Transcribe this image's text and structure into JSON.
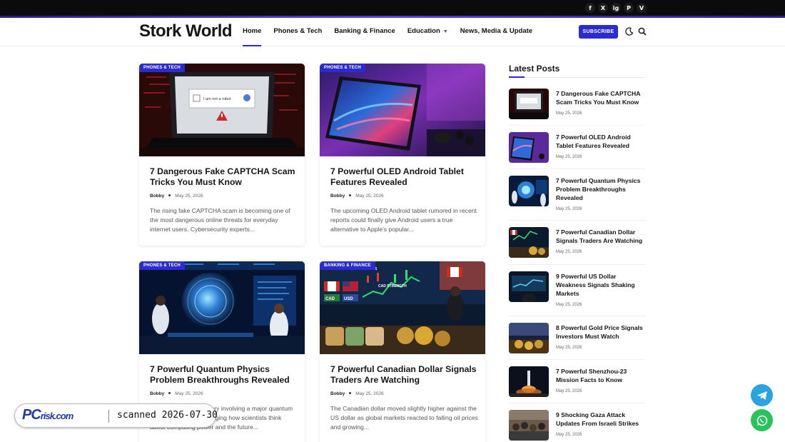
{
  "site": {
    "logo": "Stork World"
  },
  "nav": {
    "items": [
      {
        "label": "Home",
        "active": true
      },
      {
        "label": "Phones & Tech"
      },
      {
        "label": "Banking & Finance"
      },
      {
        "label": "Education",
        "dropdown": true
      },
      {
        "label": "News, Media & Update"
      }
    ],
    "subscribe_label": "SUBSCRIBE"
  },
  "socials": [
    "f",
    "X",
    "ig",
    "P",
    "V"
  ],
  "cards": [
    {
      "category": "PHONES & TECH",
      "title": "7 Dangerous Fake CAPTCHA Scam Tricks You Must Know",
      "author": "Bobby",
      "date": "May 25, 2026",
      "excerpt": "The rising fake CAPTCHA scam is becoming one of the most dangerous online threats for everyday internet users. Cybersecurity experts..."
    },
    {
      "category": "PHONES & TECH",
      "title": "7 Powerful OLED Android Tablet Features Revealed",
      "author": "Bobby",
      "date": "May 25, 2026",
      "excerpt": "The upcoming OLED Android tablet rumored in recent reports could finally give Android users a true alternative to Apple's popular..."
    },
    {
      "category": "PHONES & TECH",
      "title": "7 Powerful Quantum Physics Problem Breakthroughs Revealed",
      "author": "Bobby",
      "date": "May 25, 2026",
      "excerpt": "A new scientific discovery involving a major quantum physics problem is changing how scientists think about computing power and the future..."
    },
    {
      "category": "BANKING & FINANCE",
      "title": "7 Powerful Canadian Dollar Signals Traders Are Watching",
      "author": "Bobby",
      "date": "May 25, 2026",
      "excerpt": "The Canadian dollar moved slightly higher against the US dollar as global markets reacted to falling oil prices and growing..."
    }
  ],
  "sidebar": {
    "title": "Latest Posts",
    "posts": [
      {
        "title": "7 Dangerous Fake CAPTCHA Scam Tricks You Must Know",
        "date": "May 25, 2026"
      },
      {
        "title": "7 Powerful OLED Android Tablet Features Revealed",
        "date": "May 25, 2026"
      },
      {
        "title": "7 Powerful Quantum Physics Problem Breakthroughs Revealed",
        "date": "May 25, 2026"
      },
      {
        "title": "7 Powerful Canadian Dollar Signals Traders Are Watching",
        "date": "May 25, 2026"
      },
      {
        "title": "9 Powerful US Dollar Weakness Signals Shaking Markets",
        "date": "May 25, 2026"
      },
      {
        "title": "8 Powerful Gold Price Signals Investors Must Watch",
        "date": "May 25, 2026"
      },
      {
        "title": "7 Powerful Shenzhou-23 Mission Facts to Know",
        "date": "May 25, 2026"
      },
      {
        "title": "9 Shocking Gaza Attack Updates From Israeli Strikes",
        "date": "May 25, 2026"
      }
    ]
  },
  "image_text": {
    "captcha": "I am not a robot",
    "flags": [
      "CAD",
      "USD"
    ],
    "market_labels": [
      "OIL PRICES",
      "CAD STRENGTH"
    ]
  },
  "watermark": {
    "logo": "PC",
    "logo_domain": "risk.com",
    "text": "scanned 2026-07-30"
  },
  "colors": {
    "accent": "#2b2bcf",
    "telegram": "#2aa3df",
    "whatsapp": "#29c25b"
  }
}
